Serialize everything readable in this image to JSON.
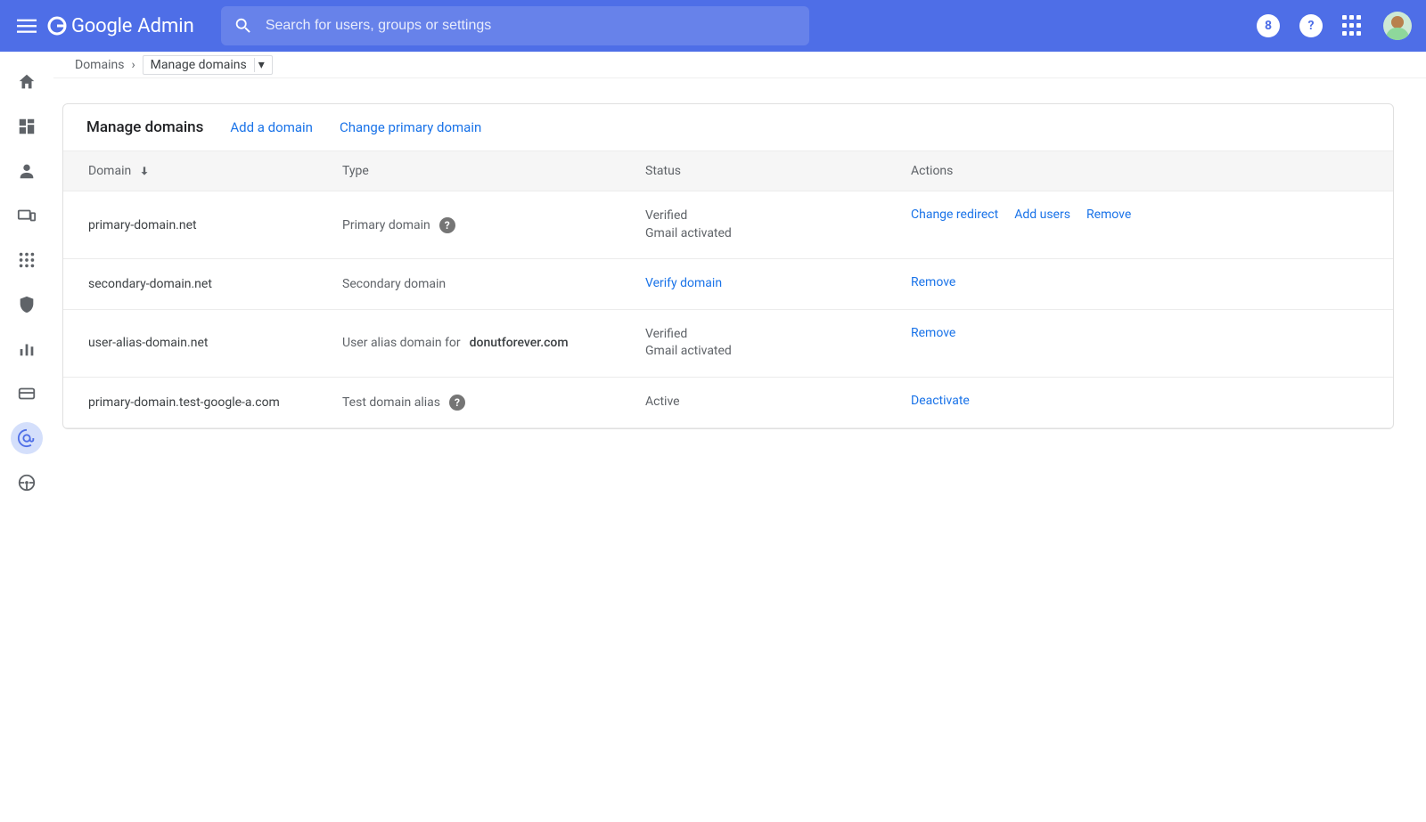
{
  "header": {
    "logo_brand": "Google",
    "logo_product": "Admin",
    "search_placeholder": "Search for users, groups or settings",
    "account_badge": "8",
    "help_badge": "?"
  },
  "breadcrumbs": {
    "root": "Domains",
    "current": "Manage domains"
  },
  "card": {
    "title": "Manage domains",
    "add_domain": "Add a domain",
    "change_primary": "Change primary domain",
    "columns": {
      "domain": "Domain",
      "type": "Type",
      "status": "Status",
      "actions": "Actions"
    }
  },
  "rows": [
    {
      "domain": "primary-domain.net",
      "type_text": "Primary domain",
      "type_has_help": true,
      "type_bold_suffix": "",
      "status_lines": [
        "Verified",
        "Gmail activated"
      ],
      "status_is_link": false,
      "actions": [
        "Change redirect",
        "Add users",
        "Remove"
      ]
    },
    {
      "domain": "secondary-domain.net",
      "type_text": "Secondary domain",
      "type_has_help": false,
      "type_bold_suffix": "",
      "status_lines": [
        "Verify domain"
      ],
      "status_is_link": true,
      "actions": [
        "Remove"
      ]
    },
    {
      "domain": "user-alias-domain.net",
      "type_text": "User alias domain for ",
      "type_has_help": false,
      "type_bold_suffix": "donutforever.com",
      "status_lines": [
        "Verified",
        "Gmail activated"
      ],
      "status_is_link": false,
      "actions": [
        "Remove"
      ]
    },
    {
      "domain": "primary-domain.test-google-a.com",
      "type_text": "Test domain alias",
      "type_has_help": true,
      "type_bold_suffix": "",
      "status_lines": [
        "Active"
      ],
      "status_is_link": false,
      "actions": [
        "Deactivate"
      ]
    }
  ],
  "rail": [
    {
      "name": "home-icon",
      "active": false
    },
    {
      "name": "dashboard-icon",
      "active": false
    },
    {
      "name": "person-icon",
      "active": false
    },
    {
      "name": "devices-icon",
      "active": false
    },
    {
      "name": "apps-grid-icon",
      "active": false
    },
    {
      "name": "shield-icon",
      "active": false
    },
    {
      "name": "analytics-icon",
      "active": false
    },
    {
      "name": "billing-icon",
      "active": false
    },
    {
      "name": "at-sign-icon",
      "active": true
    },
    {
      "name": "steering-icon",
      "active": false
    }
  ]
}
